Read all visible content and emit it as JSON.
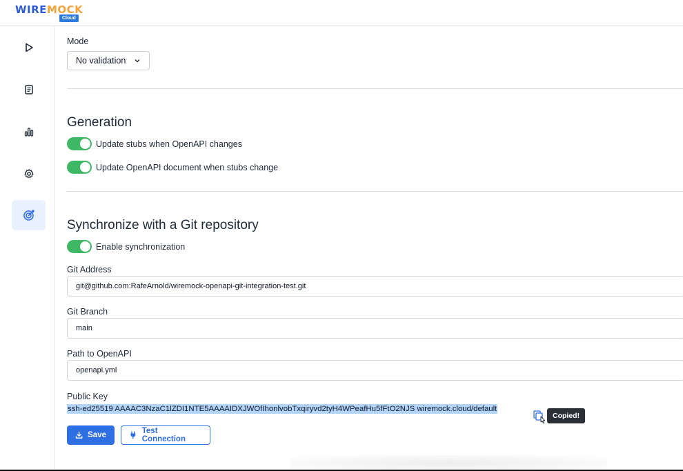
{
  "app": {
    "logo_word_1": "WIRE",
    "logo_word_2": "MOCK",
    "logo_badge": "Cloud"
  },
  "sidebar": {
    "items": [
      {
        "icon": "play-icon",
        "active": false
      },
      {
        "icon": "document-icon",
        "active": false
      },
      {
        "icon": "bar-chart-icon",
        "active": false
      },
      {
        "icon": "gear-icon",
        "active": false
      },
      {
        "icon": "target-icon",
        "active": true
      }
    ]
  },
  "mode": {
    "label": "Mode",
    "selected": "No validation"
  },
  "generation": {
    "heading": "Generation",
    "toggles": [
      {
        "label": "Update stubs when OpenAPI changes",
        "on": true
      },
      {
        "label": "Update OpenAPI document when stubs change",
        "on": true
      }
    ]
  },
  "git": {
    "heading": "Synchronize with a Git repository",
    "enable_label": "Enable synchronization",
    "enable_on": true,
    "address_label": "Git Address",
    "address_value": "git@github.com:RafeArnold/wiremock-openapi-git-integration-test.git",
    "branch_label": "Git Branch",
    "branch_value": "main",
    "path_label": "Path to OpenAPI",
    "path_value": "openapi.yml",
    "pubkey_label": "Public Key",
    "pubkey_value": "ssh-ed25519 AAAAC3NzaC1lZDI1NTE5AAAAIDXJWOfIhonlvobTxqiryvd2tyH4WPeafHu5fFtO2NJS wiremock.cloud/default",
    "copied_tooltip": "Copied!",
    "save_label": "Save",
    "test_label": "Test Connection"
  },
  "colors": {
    "accent": "#2f6fe4",
    "toggle_on": "#3fb865",
    "selection": "#b3d4f9"
  }
}
